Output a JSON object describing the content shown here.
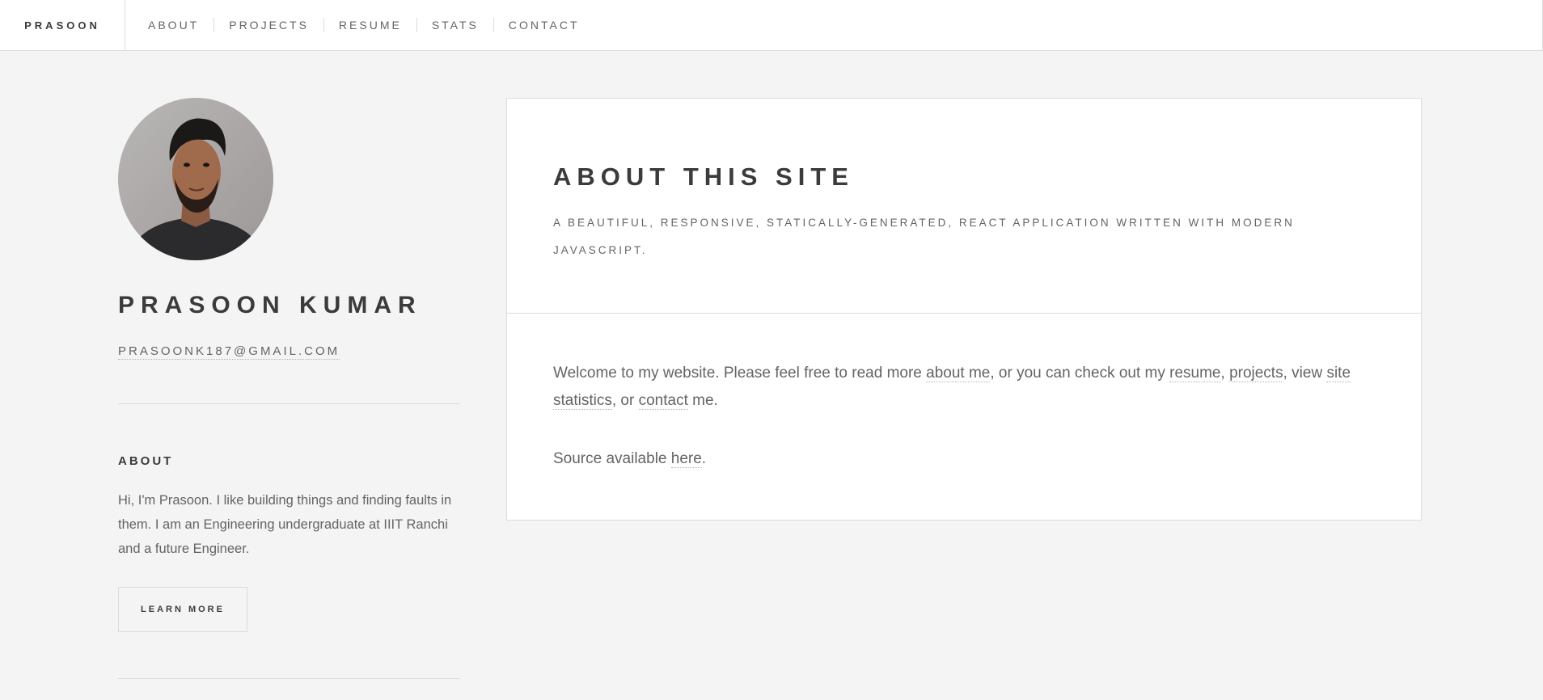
{
  "header": {
    "brand": "Prasoon",
    "nav": [
      {
        "label": "About"
      },
      {
        "label": "Projects"
      },
      {
        "label": "Resume"
      },
      {
        "label": "Stats"
      },
      {
        "label": "Contact"
      }
    ]
  },
  "sidebar": {
    "avatar_icon": "person-portrait",
    "name": "Prasoon Kumar",
    "email": "prasoonk187@gmail.com",
    "about_heading": "About",
    "about_text": "Hi, I'm Prasoon. I like building things and finding faults in them. I am an Engineering undergraduate at IIIT Ranchi and a future Engineer.",
    "learn_more": "Learn More"
  },
  "main": {
    "title": "About this site",
    "subtitle": "A beautiful, responsive, statically-generated, react application written with modern Javascript.",
    "intro": {
      "t1": "Welcome to my website. Please feel free to read more ",
      "about_link": "about me",
      "t2": ", or you can check out my ",
      "resume_link": "resume",
      "t3": ", ",
      "projects_link": "projects",
      "t4": ", view ",
      "stats_link": "site statistics",
      "t5": ", or ",
      "contact_link": "contact",
      "t6": " me."
    },
    "source": {
      "t1": "Source available ",
      "here_link": "here",
      "t2": "."
    }
  },
  "colors": {
    "background": "#f4f4f4",
    "card": "#ffffff",
    "heading": "#3c3b3b",
    "text": "#646464",
    "border": "#dcdcdc"
  }
}
